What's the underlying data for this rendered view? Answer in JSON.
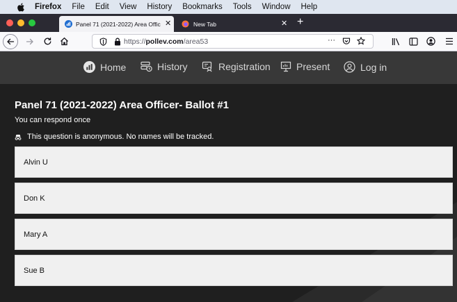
{
  "menubar": {
    "app_name": "Firefox",
    "items": [
      "File",
      "Edit",
      "View",
      "History",
      "Bookmarks",
      "Tools",
      "Window",
      "Help"
    ]
  },
  "tabs": {
    "active_title": "Panel 71 (2021-2022) Area Offic",
    "inactive_title": "New Tab",
    "close_glyph": "✕",
    "new_tab_glyph": "+"
  },
  "urlbar": {
    "scheme": "https://",
    "domain": "pollev.com",
    "path": "/area53",
    "more_glyph": "···"
  },
  "site_nav": {
    "items": [
      {
        "label": "Home",
        "icon": "polleverywhere-logo-icon"
      },
      {
        "label": "History",
        "icon": "history-icon"
      },
      {
        "label": "Registration",
        "icon": "registration-icon"
      },
      {
        "label": "Present",
        "icon": "present-icon"
      },
      {
        "label": "Log in",
        "icon": "user-icon"
      }
    ]
  },
  "poll": {
    "title": "Panel 71 (2021-2022) Area Officer- Ballot #1",
    "subtitle": "You can respond once",
    "anonymous_note": "This question is anonymous. No names will be tracked.",
    "choices": [
      "Alvin U",
      "Don K",
      "Mary A",
      "Sue B"
    ]
  },
  "colors": {
    "page_bg": "#1f1f1f",
    "nav_bg": "#383838",
    "choice_bg": "#f0f0f0",
    "tab_strip_bg": "#2b2a33"
  }
}
